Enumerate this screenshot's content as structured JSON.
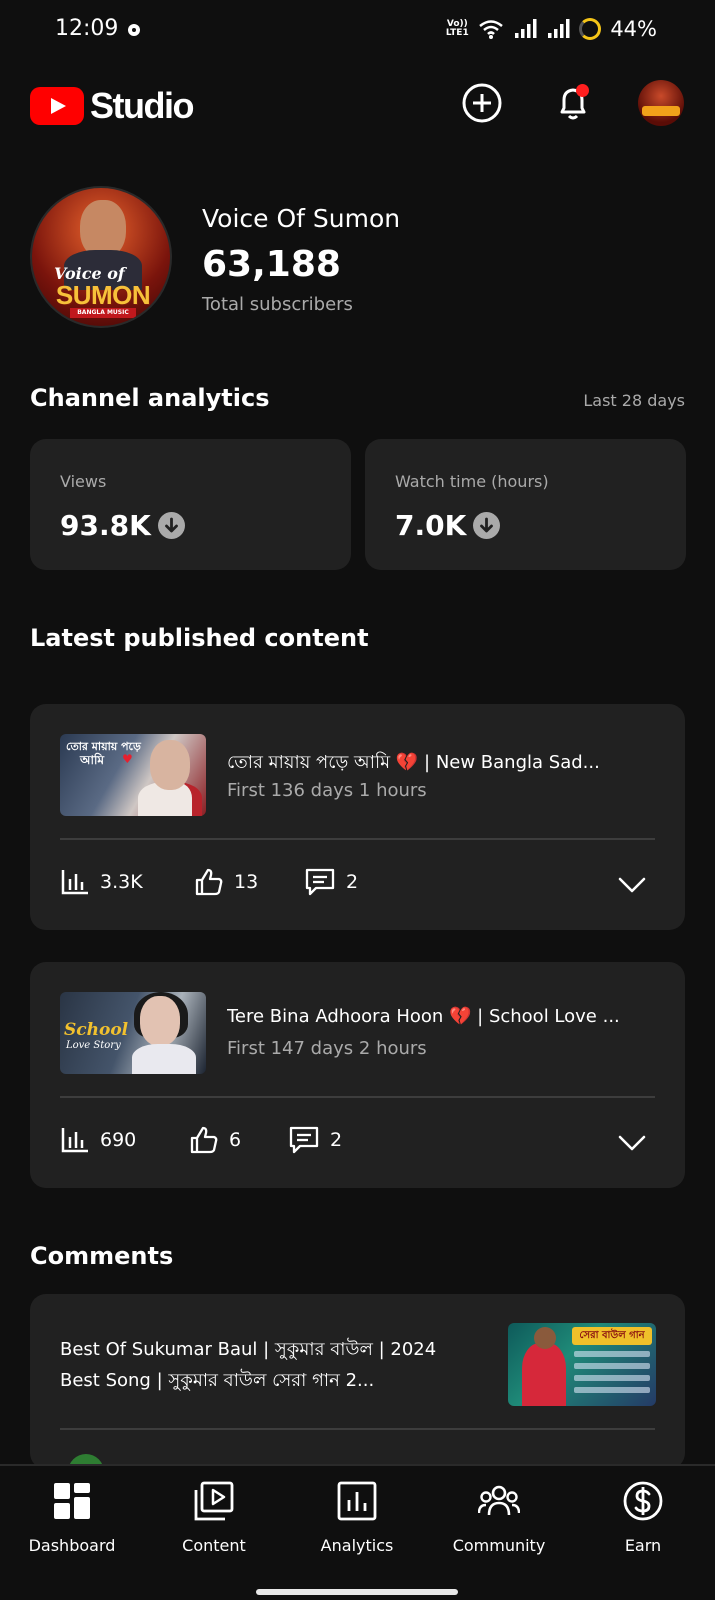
{
  "status_bar": {
    "time": "12:09",
    "network_label": "Vo)) LTE1",
    "battery": "44%"
  },
  "header": {
    "app_name": "Studio",
    "brand_color": "#ff0000",
    "icons": [
      "create-plus-icon",
      "notification-bell-icon",
      "account-avatar"
    ]
  },
  "channel": {
    "name": "Voice Of Sumon",
    "subscribers": "63,188",
    "subscribers_label": "Total subscribers",
    "avatar_art": {
      "line1": "Voice of",
      "line2": "SUMON",
      "line3": "BANGLA MUSIC"
    }
  },
  "analytics": {
    "title": "Channel analytics",
    "period": "Last 28 days",
    "cards": [
      {
        "label": "Views",
        "value": "93.8K",
        "trend": "down"
      },
      {
        "label": "Watch time (hours)",
        "value": "7.0K",
        "trend": "down"
      }
    ]
  },
  "latest": {
    "title": "Latest published content",
    "items": [
      {
        "title": "তোর মায়ায় পড়ে আমি 💔 | New Bangla Sad...",
        "subtitle": "First 136 days 1 hours",
        "views": "3.3K",
        "likes": "13",
        "comments": "2",
        "thumb_text1": "তোর মায়ায় পড়ে",
        "thumb_text2": "আমি"
      },
      {
        "title": "Tere Bina Adhoora Hoon 💔 | School Love ...",
        "subtitle": "First 147 days 2 hours",
        "views": "690",
        "likes": "6",
        "comments": "2",
        "thumb_text1": "School",
        "thumb_text2": "Love Story"
      }
    ]
  },
  "comments": {
    "title": "Comments",
    "video_title": "Best Of Sukumar Baul | সুকুমার বাউল | 2024 Best Song | সুকুমার বাউল সেরা গান 2...",
    "thumb_banner": "সেরা বাউল গান"
  },
  "bottom_nav": [
    {
      "label": "Dashboard",
      "icon": "dashboard-icon"
    },
    {
      "label": "Content",
      "icon": "content-icon"
    },
    {
      "label": "Analytics",
      "icon": "analytics-icon"
    },
    {
      "label": "Community",
      "icon": "community-icon"
    },
    {
      "label": "Earn",
      "icon": "earn-icon"
    }
  ]
}
